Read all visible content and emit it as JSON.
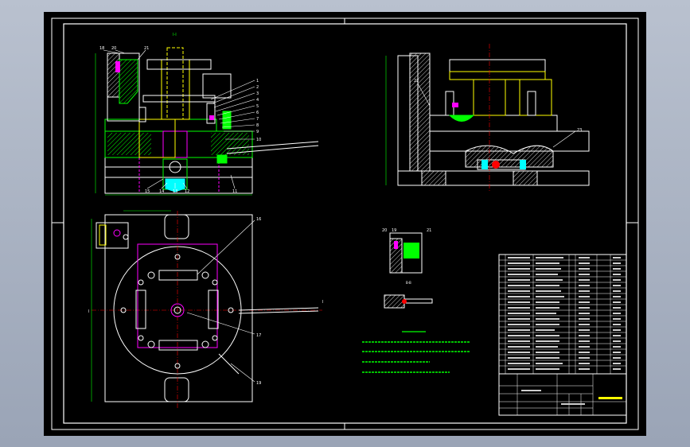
{
  "drawing": {
    "labels": {
      "section_top": "I-I",
      "callout_18": "18",
      "callout_20": "20",
      "callout_21": "21",
      "callout_1": "1",
      "callout_2": "2",
      "callout_3": "3",
      "callout_4": "4",
      "callout_5": "5",
      "callout_6": "6",
      "callout_7": "7",
      "callout_8": "8",
      "callout_9": "9",
      "callout_10": "10",
      "callout_11": "11",
      "callout_12": "12",
      "callout_13": "13",
      "callout_14": "14",
      "callout_15": "15",
      "callout_16": "16",
      "callout_17": "17",
      "callout_19": "19",
      "callout_22": "22",
      "callout_23": "23",
      "detail_20": "20",
      "detail_19": "19",
      "detail_21": "21",
      "detail_section": "B-B",
      "section_mark_left": "I",
      "section_mark_right": "I"
    },
    "colors": {
      "background": "#000000",
      "line_white": "#ffffff",
      "line_yellow": "#ffff00",
      "line_green": "#00ff00",
      "line_cyan": "#00ffff",
      "line_magenta": "#ff00ff",
      "line_red": "#ff0000"
    }
  }
}
